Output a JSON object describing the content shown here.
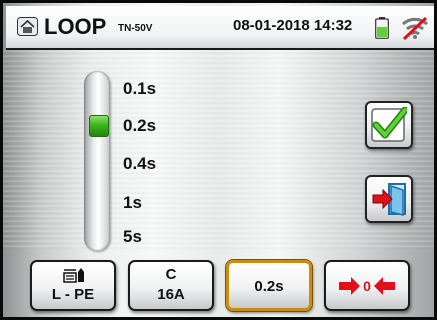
{
  "header": {
    "title": "LOOP",
    "subtitle": "TN-50V",
    "datetime": "08-01-2018 14:32",
    "icons": [
      "home-icon",
      "battery-icon",
      "no-signal-icon"
    ]
  },
  "selector": {
    "options": [
      "0.1s",
      "0.2s",
      "0.4s",
      "1s",
      "5s"
    ],
    "selected": "0.2s"
  },
  "side_buttons": {
    "confirm_icon": "checkmark-icon",
    "exit_icon": "exit-door-icon"
  },
  "bottom_buttons": {
    "mode_label": "L - PE",
    "mode_icon": "test-probe-icon",
    "protection_curve": "C",
    "protection_current": "16A",
    "trip_time": "0.2s",
    "zero_icon": "zero-calibration-icon"
  },
  "colors": {
    "accent_green": "#3fb31d",
    "accent_red": "#e0101a",
    "selected_border": "#c98e10",
    "battery_fill": "#5fd03a"
  }
}
